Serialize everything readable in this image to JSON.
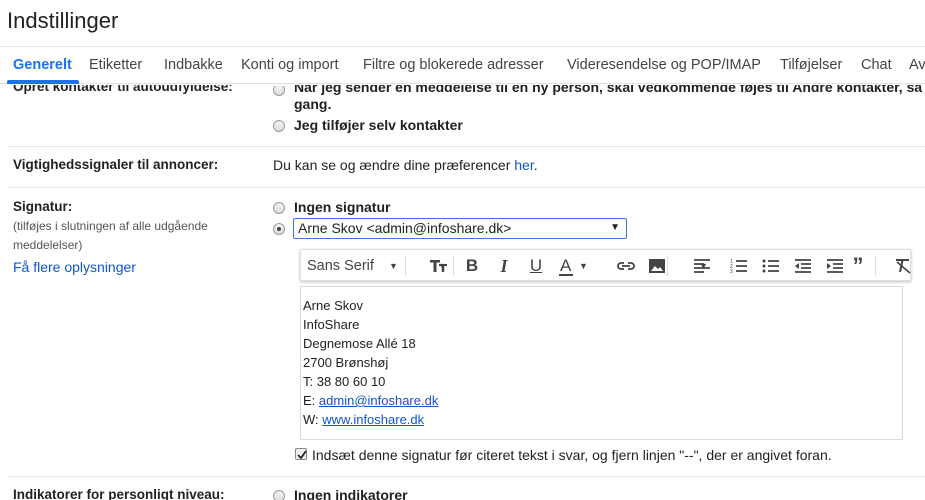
{
  "title": "Indstillinger",
  "tabs": [
    {
      "label": "Generelt",
      "active": true
    },
    {
      "label": "Etiketter"
    },
    {
      "label": "Indbakke"
    },
    {
      "label": "Konti og import"
    },
    {
      "label": "Filtre og blokerede adresser"
    },
    {
      "label": "Videresendelse og POP/IMAP"
    },
    {
      "label": "Tilføjelser"
    },
    {
      "label": "Chat"
    },
    {
      "label": "Av"
    }
  ],
  "contacts": {
    "label": "Opret kontakter til autoudfyldelse:",
    "option1_line1": "Når jeg sender en meddelelse til en ny person, skal vedkommende føjes til Andre kontakter, så jeg",
    "option1_line2": "gang.",
    "option2": "Jeg tilføjer selv kontakter"
  },
  "importance": {
    "label": "Vigtighedssignaler til annoncer:",
    "text": "Du kan se og ændre dine præferencer",
    "link": "her",
    "suffix": "."
  },
  "signature": {
    "label": "Signatur:",
    "sub1": "(tilføjes i slutningen af alle udgående",
    "sub2": "meddelelser)",
    "more_link": "Få flere oplysninger",
    "none_option": "Ingen signatur",
    "selected": "Arne Skov <admin@infoshare.dk>",
    "font_name": "Sans Serif",
    "lines": {
      "name": "Arne Skov",
      "company": "InfoShare",
      "street": "Degnemose Allé 18",
      "city": "2700 Brønshøj",
      "phone": "T: 38 80 60 10",
      "email_prefix": "E: ",
      "email": "admin@infoshare.dk",
      "web_prefix": "W: ",
      "web": "www.infoshare.dk"
    },
    "insert_before_quote": "Indsæt denne signatur før citeret tekst i svar, og fjern linjen \"--\", der er angivet foran.",
    "insert_checked": true
  },
  "indicators": {
    "label": "Indikatorer for personligt niveau:",
    "option1": "Ingen indikatorer"
  },
  "colors": {
    "accent": "#1a73e8",
    "link": "#1155cc"
  }
}
